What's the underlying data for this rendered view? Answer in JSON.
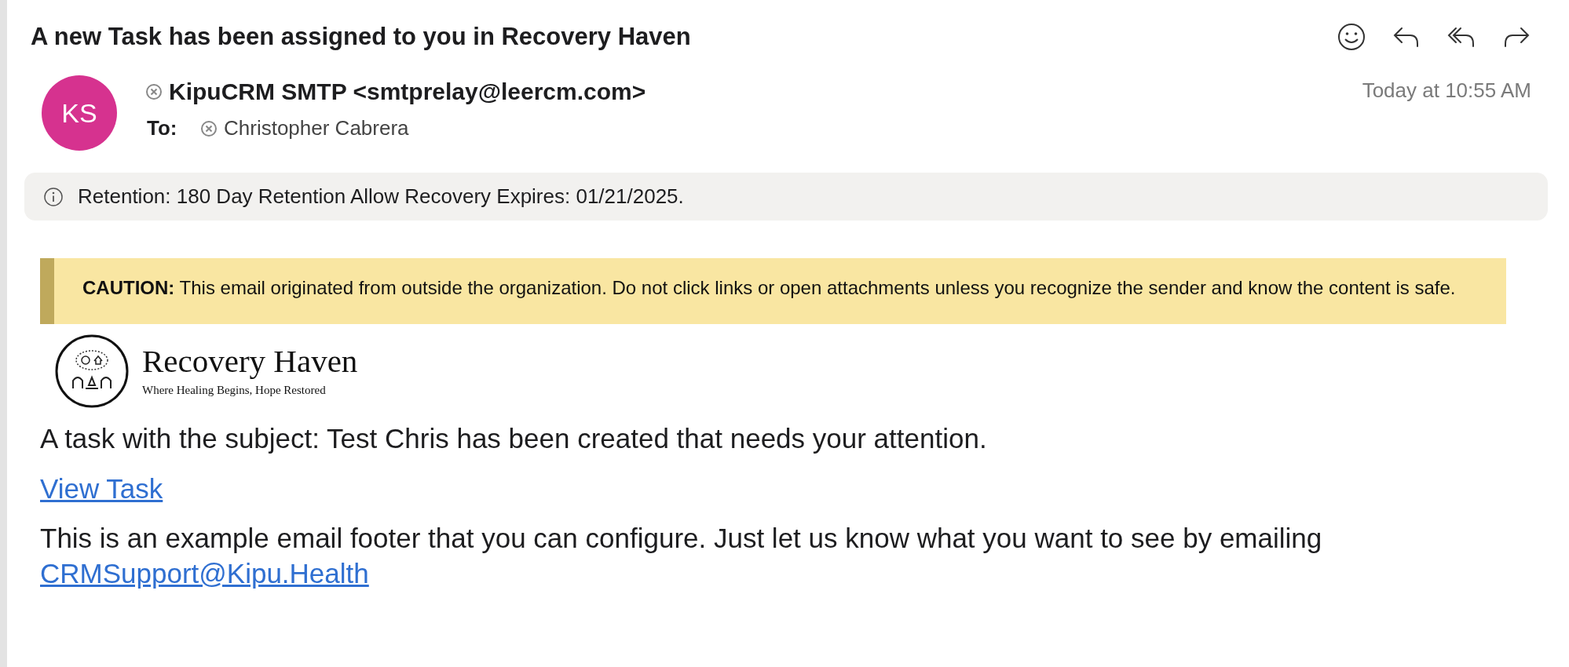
{
  "subject": "A new Task has been assigned to you in Recovery Haven",
  "sender": {
    "initials": "KS",
    "name": "KipuCRM SMTP <smtprelay@leercm.com>",
    "to_label": "To:",
    "recipient": "Christopher Cabrera",
    "date": "Today at 10:55 AM"
  },
  "retention_notice": "Retention: 180 Day Retention Allow Recovery Expires: 01/21/2025.",
  "caution": "**CAUTION:** This email originated from outside the organization. Do not click links or open attachments unless you recognize the sender and know the content is safe.",
  "logo": {
    "name": "Recovery Haven",
    "tagline": "Where Healing Begins, Hope Restored"
  },
  "body": {
    "message": "A task with the subject: Test Chris has been created that needs your attention.",
    "link": "View Task",
    "footer": "This is an example email footer that you can configure. Just let us know what you want to see by emailing",
    "footer_link": "CRMSupport@Kipu.Health"
  }
}
